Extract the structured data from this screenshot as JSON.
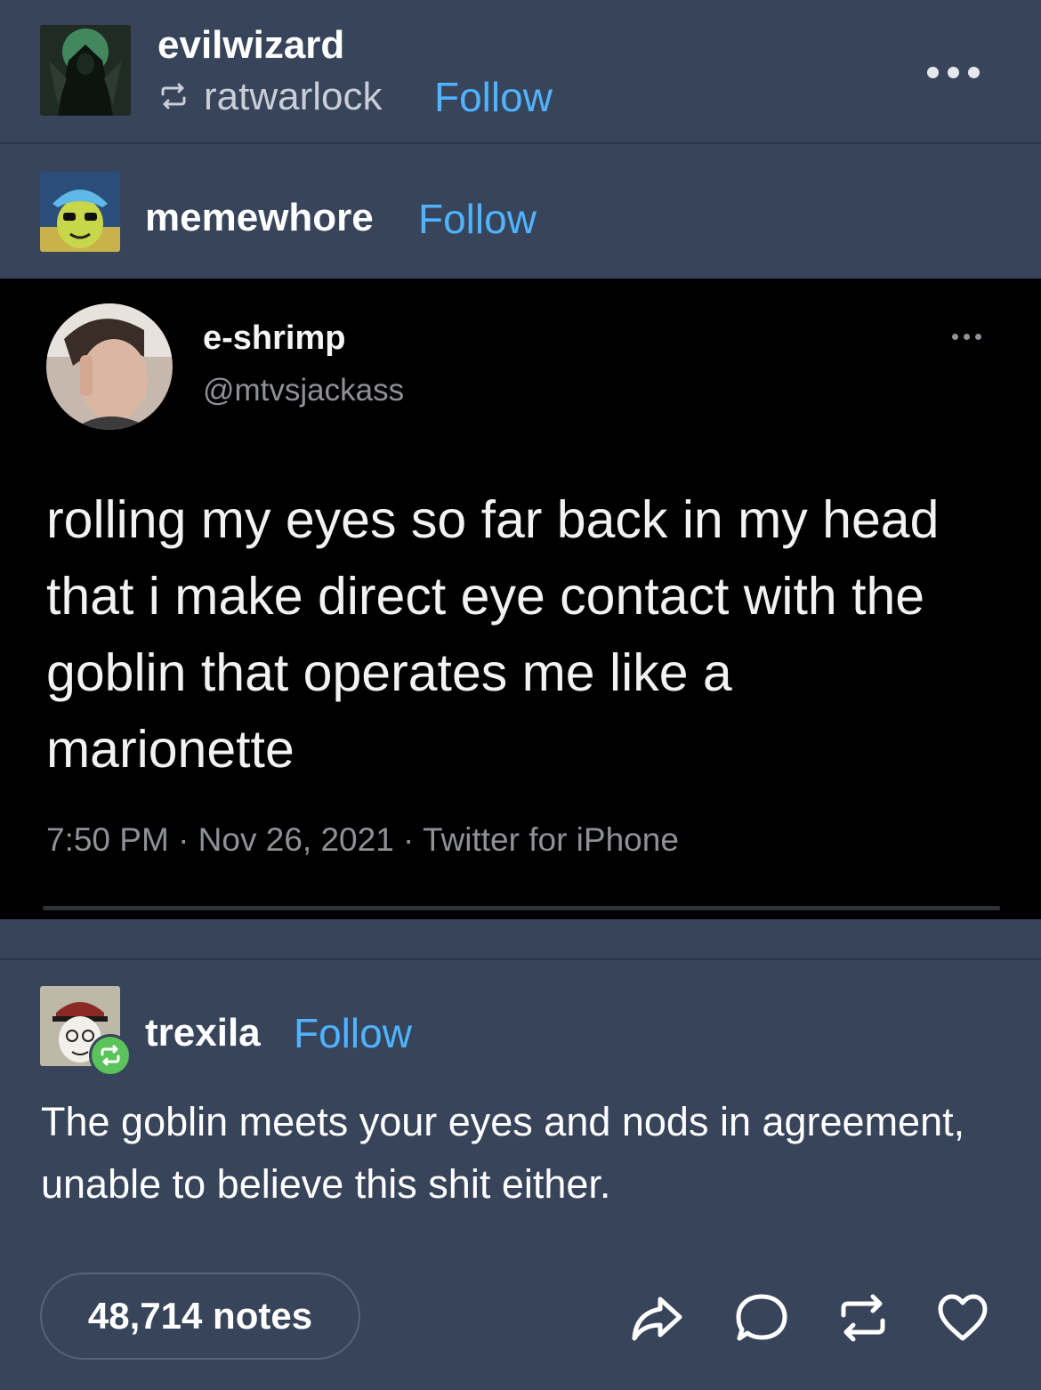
{
  "header": {
    "blog_name": "evilwizard",
    "reblogged_from": "ratwarlock",
    "follow_label": "Follow",
    "more_icon": "more-dots-icon"
  },
  "original_post": {
    "username": "memewhore",
    "follow_label": "Follow",
    "tweet": {
      "display_name": "e-shrimp",
      "handle": "@mtvsjackass",
      "text": "rolling my eyes so far back in my head that i make direct eye contact with the goblin that operates me like a marionette",
      "meta": "7:50 PM · Nov 26, 2021 · Twitter for iPhone"
    }
  },
  "reblog": {
    "username": "trexila",
    "follow_label": "Follow",
    "badge_icon": "reblog-badge-icon",
    "text": "The goblin meets your eyes and nods in agreement, unable to believe this shit either."
  },
  "footer": {
    "notes_label": "48,714 notes",
    "actions": [
      "share-icon",
      "comment-icon",
      "reblog-icon",
      "like-icon"
    ]
  },
  "colors": {
    "background": "#37445a",
    "accent": "#4fb3ff",
    "reblog_badge": "#5ac35a"
  }
}
